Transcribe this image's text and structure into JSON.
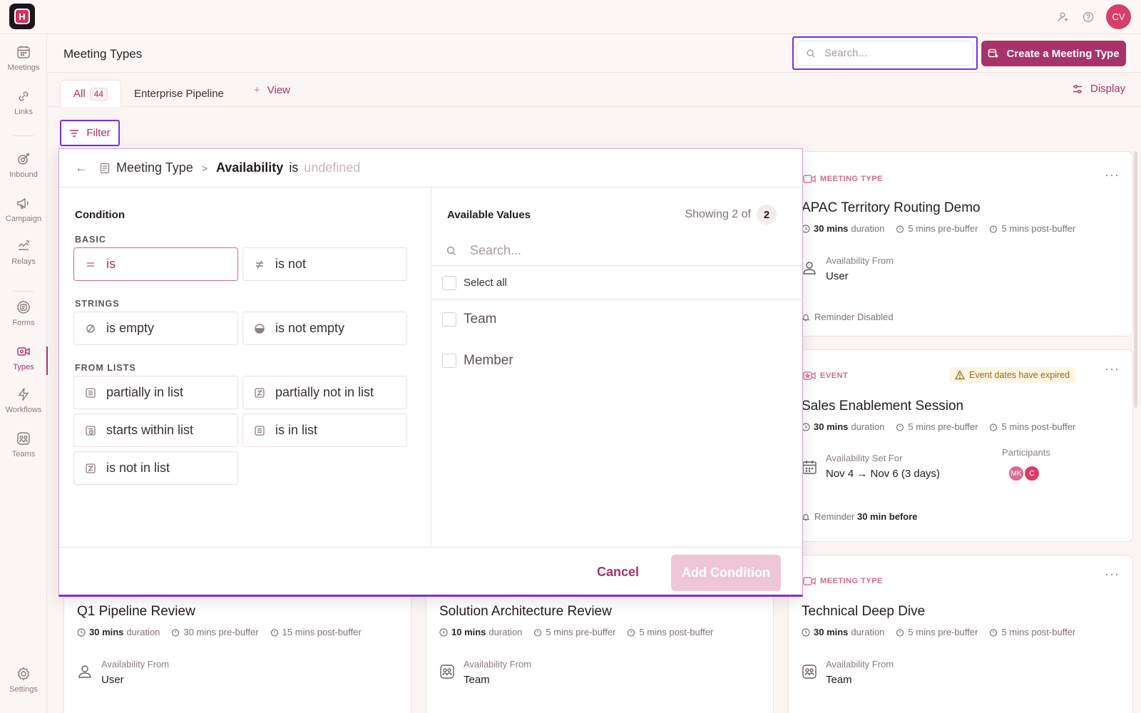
{
  "app": {
    "logo_glyph": "H",
    "avatar_initials": "CV"
  },
  "sidebar": {
    "items": [
      {
        "label": "Meetings",
        "icon": "calendar-icon"
      },
      {
        "label": "Links",
        "icon": "link-icon"
      },
      {
        "label": "Inbound",
        "icon": "inbound-icon"
      },
      {
        "label": "Campaign",
        "icon": "megaphone-icon"
      },
      {
        "label": "Relays",
        "icon": "relay-icon"
      },
      {
        "label": "Forms",
        "icon": "forms-icon"
      },
      {
        "label": "Types",
        "icon": "video-icon"
      },
      {
        "label": "Workflows",
        "icon": "lightning-icon"
      },
      {
        "label": "Teams",
        "icon": "teams-icon"
      },
      {
        "label": "Settings",
        "icon": "gear-icon"
      }
    ],
    "active": "Types"
  },
  "header": {
    "title": "Meeting Types",
    "search_placeholder": "Search...",
    "create_label": "Create a Meeting Type"
  },
  "tabs": {
    "all_label": "All",
    "all_count": "44",
    "pipeline_label": "Enterprise Pipeline",
    "view_label": "View",
    "display_label": "Display"
  },
  "filter": {
    "label": "Filter"
  },
  "popover": {
    "crumb": "Meeting Type",
    "attribute": "Availability",
    "operator": "is",
    "value": "undefined",
    "condition_title": "Condition",
    "groups": {
      "basic": "BASIC",
      "strings": "STRINGS",
      "lists": "FROM LISTS"
    },
    "options": {
      "is": "is",
      "is_not": "is not",
      "is_empty": "is empty",
      "is_not_empty": "is not empty",
      "partially_in_list": "partially in list",
      "partially_not_in_list": "partially not in list",
      "starts_within_list": "starts within list",
      "is_in_list": "is in list",
      "is_not_in_list": "is not in list"
    },
    "selected": "is",
    "values_title": "Available Values",
    "showing_text": "Showing 2 of",
    "showing_count": "2",
    "values_search_placeholder": "Search...",
    "select_all": "Select all",
    "values": [
      "Team",
      "Member"
    ],
    "cancel": "Cancel",
    "add": "Add Condition"
  },
  "cards": {
    "apac": {
      "type": "MEETING TYPE",
      "title": "APAC Territory Routing Demo",
      "duration": "30 mins",
      "duration_suffix": "duration",
      "pre": "5 mins pre-buffer",
      "post": "5 mins post-buffer",
      "avail_label": "Availability From",
      "avail_value": "User",
      "reminder": "Reminder Disabled"
    },
    "sales": {
      "type": "EVENT",
      "warning": "Event dates have expired",
      "title": "Sales Enablement Session",
      "duration": "30 mins",
      "duration_suffix": "duration",
      "pre": "5 mins pre-buffer",
      "post": "5 mins post-buffer",
      "avail_label": "Availability Set For",
      "avail_value": "Nov 4 → Nov 6 (3 days)",
      "participants_label": "Participants",
      "participants": [
        "MK",
        "C"
      ],
      "reminder_prefix": "Reminder",
      "reminder_value": "30 min before"
    },
    "tech": {
      "type": "MEETING TYPE",
      "title": "Technical Deep Dive",
      "duration": "30 mins",
      "duration_suffix": "duration",
      "pre": "5 mins pre-buffer",
      "post": "5 mins post-buffer",
      "avail_label": "Availability From",
      "avail_value": "Team"
    },
    "q1": {
      "title": "Q1 Pipeline Review",
      "duration": "30 mins",
      "duration_suffix": "duration",
      "pre": "30 mins pre-buffer",
      "post": "15 mins post-buffer",
      "avail_label": "Availability From",
      "avail_value": "User"
    },
    "sol": {
      "title": "Solution Architecture Review",
      "duration": "10 mins",
      "duration_suffix": "duration",
      "pre": "5 mins pre-buffer",
      "post": "5 mins post-buffer",
      "avail_label": "Availability From",
      "avail_value": "Team"
    }
  },
  "colors": {
    "accent": "#a8326a",
    "focus": "#7a2ee6",
    "warning_bg": "#fdf6e4"
  }
}
